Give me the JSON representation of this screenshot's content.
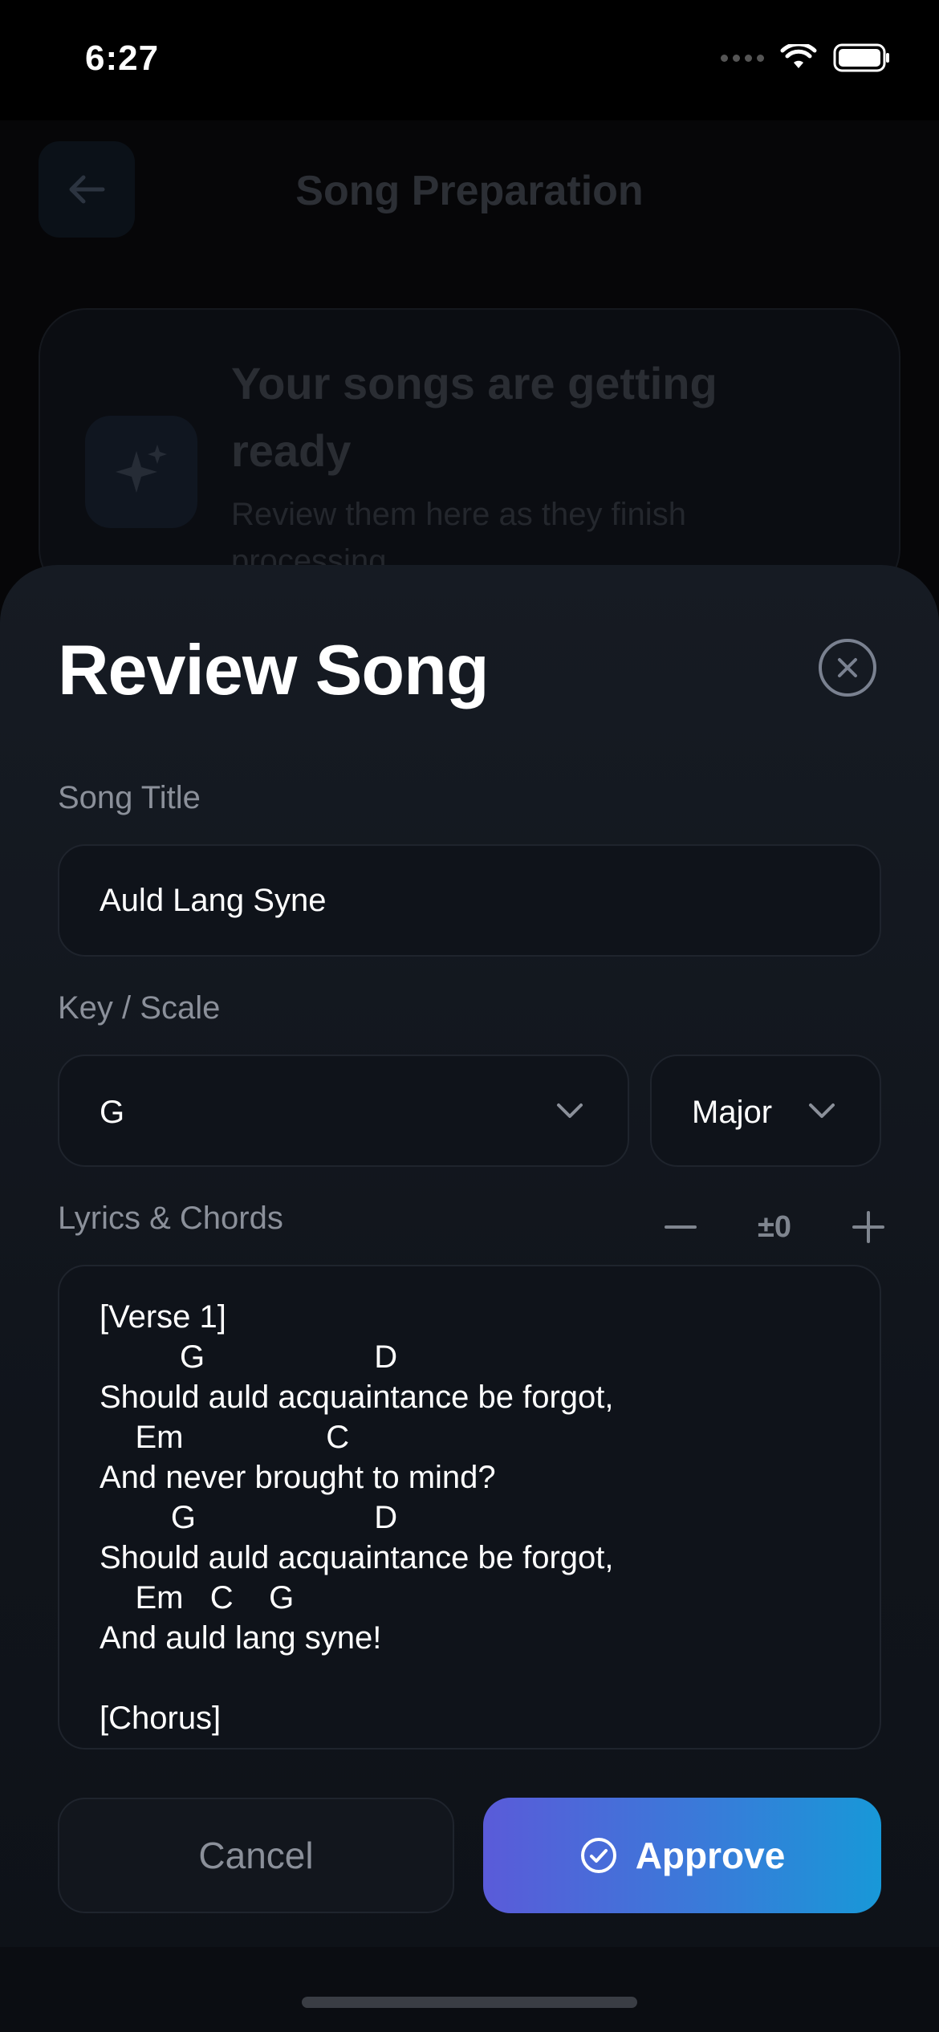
{
  "status_bar": {
    "time": "6:27"
  },
  "background": {
    "header_title": "Song Preparation",
    "card_title": "Your songs are getting ready",
    "card_subtitle": "Review them here as they finish processing"
  },
  "sheet": {
    "title": "Review Song",
    "song_title_label": "Song Title",
    "song_title_value": "Auld Lang Syne",
    "key_label": "Key / Scale",
    "key_value": "G",
    "scale_value": "Major",
    "lyrics_label": "Lyrics & Chords",
    "transpose_value": "±0",
    "lyrics": "[Verse 1]\n         G                   D\nShould auld acquaintance be forgot,\n    Em                C\nAnd never brought to mind?\n        G                    D\nShould auld acquaintance be forgot,\n    Em   C    G\nAnd auld lang syne!\n\n[Chorus]",
    "cancel_label": "Cancel",
    "approve_label": "Approve"
  },
  "colors": {
    "approve_gradient_start": "#5a5bd9",
    "approve_gradient_end": "#1898d8",
    "label_gray": "#8b909a"
  }
}
